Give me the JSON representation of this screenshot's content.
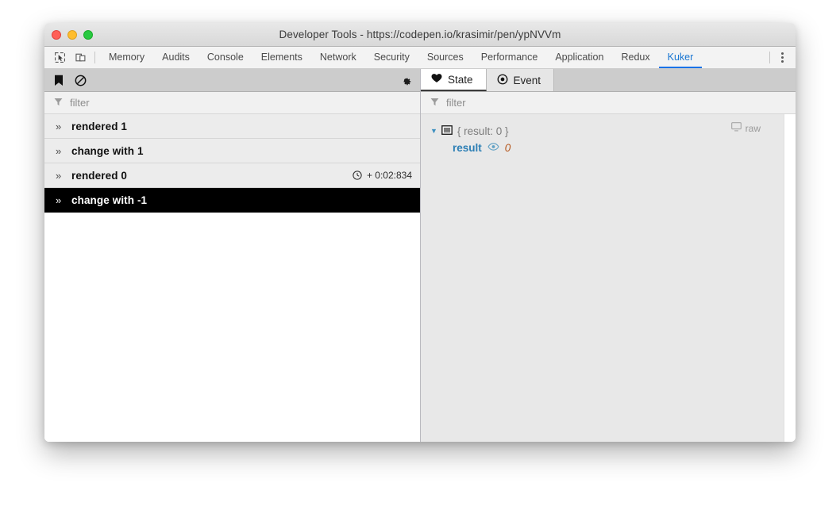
{
  "window": {
    "title": "Developer Tools - https://codepen.io/krasimir/pen/ypNVVm",
    "traffic_lights": [
      "close",
      "minimize",
      "zoom"
    ]
  },
  "devtools": {
    "icons": [
      "inspect-element-icon",
      "device-toolbar-icon"
    ],
    "tabs": [
      {
        "label": "Memory",
        "active": false
      },
      {
        "label": "Audits",
        "active": false
      },
      {
        "label": "Console",
        "active": false
      },
      {
        "label": "Elements",
        "active": false
      },
      {
        "label": "Network",
        "active": false
      },
      {
        "label": "Security",
        "active": false
      },
      {
        "label": "Sources",
        "active": false
      },
      {
        "label": "Performance",
        "active": false
      },
      {
        "label": "Application",
        "active": false
      },
      {
        "label": "Redux",
        "active": false
      },
      {
        "label": "Kuker",
        "active": true
      }
    ],
    "active_tab": "Kuker",
    "accent_color": "#1a73e8",
    "more_menu": "more-options"
  },
  "left_panel": {
    "toolbar": {
      "bookmark_label": "bookmark",
      "clear_label": "clear",
      "settings_label": "settings"
    },
    "filter": {
      "placeholder": "filter",
      "value": ""
    },
    "events": [
      {
        "title": "rendered 1",
        "time": "",
        "selected": false
      },
      {
        "title": "change with 1",
        "time": "",
        "selected": false
      },
      {
        "title": "rendered 0",
        "time": "+ 0:02:834",
        "selected": false
      },
      {
        "title": "change with -1",
        "time": "",
        "selected": true
      }
    ]
  },
  "right_panel": {
    "tabs": [
      {
        "label": "State",
        "icon": "heart-icon",
        "active": true
      },
      {
        "label": "Event",
        "icon": "target-icon",
        "active": false
      }
    ],
    "filter": {
      "placeholder": "filter",
      "value": ""
    },
    "raw_label": "raw",
    "tree": {
      "summary": "{ result: 0 }",
      "key": "result",
      "value": "0",
      "key_color": "#2d7fb5",
      "value_color": "#b5561c"
    }
  }
}
